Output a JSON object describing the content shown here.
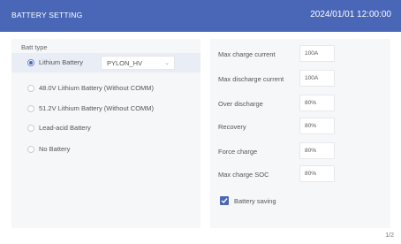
{
  "header": {
    "title": "BATTERY SETTING",
    "datetime": "2024/01/01 12:00:00"
  },
  "battery_type": {
    "label": "Batt type",
    "options": [
      {
        "label": "Lithium Battery",
        "selected": true
      },
      {
        "label": "48.0V Lithium Battery (Without COMM)",
        "selected": false
      },
      {
        "label": "51.2V Lithium Battery (Without COMM)",
        "selected": false
      },
      {
        "label": "Lead-acid Battery",
        "selected": false
      },
      {
        "label": "No Battery",
        "selected": false
      }
    ],
    "protocol_dropdown": {
      "value": "PYLON_HV",
      "icon": "chevron-down-icon"
    }
  },
  "settings": {
    "max_charge_current": {
      "label": "Max charge current",
      "value": "100A"
    },
    "max_discharge_current": {
      "label": "Max discharge current",
      "value": "100A"
    },
    "over_discharge": {
      "label": "Over discharge",
      "value": "80%"
    },
    "recovery": {
      "label": "Recovery",
      "value": "80%"
    },
    "force_charge": {
      "label": "Force charge",
      "value": "80%"
    },
    "max_charge_soc": {
      "label": "Max charge SOC",
      "value": "80%"
    }
  },
  "battery_saving": {
    "label": "Battery saving",
    "checked": true
  },
  "pagination": {
    "indicator": "1/2"
  },
  "colors": {
    "accent": "#4a67b7",
    "panel": "#f6f7f9",
    "background": "#ffffff"
  }
}
